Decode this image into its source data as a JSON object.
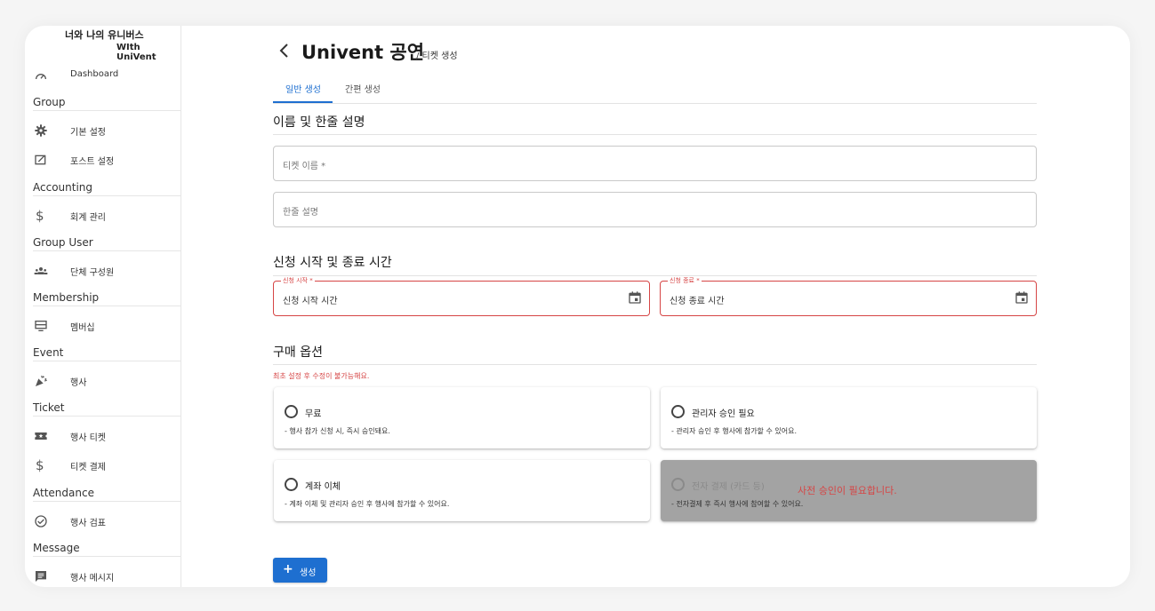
{
  "brand": {
    "line1": "너와 나의 유니버스",
    "line2": "WIth UniVent"
  },
  "sidebar": {
    "dashboard": "Dashboard",
    "sections": {
      "group": "Group",
      "accounting": "Accounting",
      "group_user": "Group User",
      "membership": "Membership",
      "event": "Event",
      "ticket": "Ticket",
      "attendance": "Attendance",
      "message": "Message"
    },
    "items": {
      "basic_settings": "기본 설정",
      "post_settings": "포스트 설정",
      "accounting_mgmt": "회계 관리",
      "group_members": "단체 구성원",
      "membership": "멤버십",
      "event": "행사",
      "event_ticket": "행사 티켓",
      "ticket_payment": "티켓 결제",
      "event_check": "행사 검표",
      "event_message": "행사 메시지"
    }
  },
  "header": {
    "title": "Univent 공연",
    "subtitle": "/ 티켓 생성"
  },
  "tabs": {
    "general": "일반 생성",
    "simple": "간편 생성"
  },
  "section1": {
    "title": "이름 및 한줄 설명",
    "ticket_name_placeholder": "티켓 이름 *",
    "short_desc_placeholder": "한줄 설명"
  },
  "section2": {
    "title": "신청 시작 및 종료 시간",
    "start_label": "신청 시작 *",
    "start_value": "신청 시작 시간",
    "end_label": "신청 종료 *",
    "end_value": "신청 종료 시간"
  },
  "section3": {
    "title": "구매 옵션",
    "note": "최초 설정 후 수정이 불가능해요.",
    "options": {
      "free": {
        "title": "무료",
        "desc": "- 행사 참가 신청 시, 즉시 승인돼요."
      },
      "admin": {
        "title": "관리자 승인 필요",
        "desc": "- 관리자 승인 후 행사에 참가할 수 있어요."
      },
      "transfer": {
        "title": "계좌 이체",
        "desc": "- 계좌 이체 및 관리자 승인 후 행사에 참가할 수 있어요."
      },
      "card": {
        "title": "전자 결제 (카드 등)",
        "desc": "- 전자결제 후 즉시 행사에 참여할 수 있어요.",
        "warning": "사전 승인이 필요합니다."
      }
    }
  },
  "create_button": "생성",
  "colors": {
    "accent": "#1e6fd0",
    "error": "#d64545",
    "disabled": "#a3a3a3"
  }
}
